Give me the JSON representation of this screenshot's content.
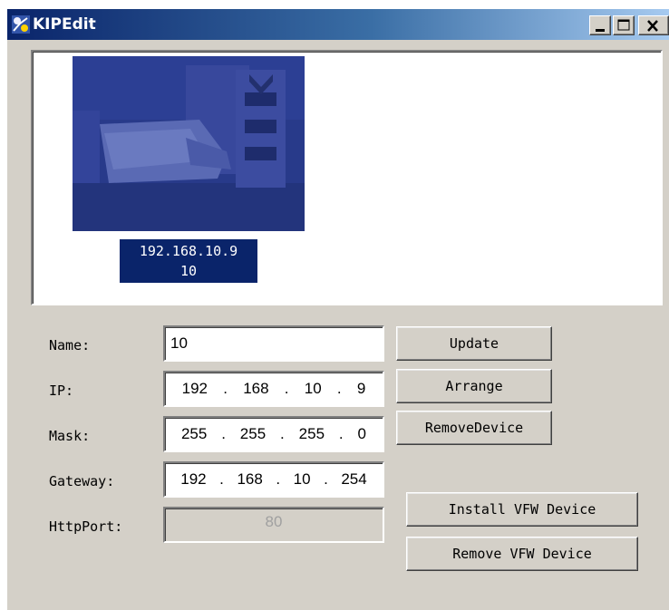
{
  "window": {
    "title": "KIPEdit",
    "title_bg": "#0a246a",
    "face_color": "#d4d0c8"
  },
  "preview": {
    "device": {
      "ip": "192.168.10.9",
      "name": "10",
      "selected_color": "#0a246a"
    }
  },
  "form": {
    "name_label": "Name:",
    "name_value": "10",
    "ip_label": "IP:",
    "ip_octets": [
      "192",
      ".",
      "168",
      ".",
      "10",
      ".",
      "9"
    ],
    "mask_label": "Mask:",
    "mask_octets": [
      "255",
      ".",
      "255",
      ".",
      "255",
      ".",
      "0"
    ],
    "gateway_label": "Gateway:",
    "gateway_octets": [
      "192",
      ".",
      "168",
      ".",
      "10",
      ".",
      "254"
    ],
    "httpport_label": "HttpPort:",
    "httpport_value": "80"
  },
  "buttons": {
    "update": "Update",
    "arrange": "Arrange",
    "remove_device": "RemoveDevice",
    "install_vfw": "Install VFW Device",
    "remove_vfw": "Remove VFW Device"
  }
}
